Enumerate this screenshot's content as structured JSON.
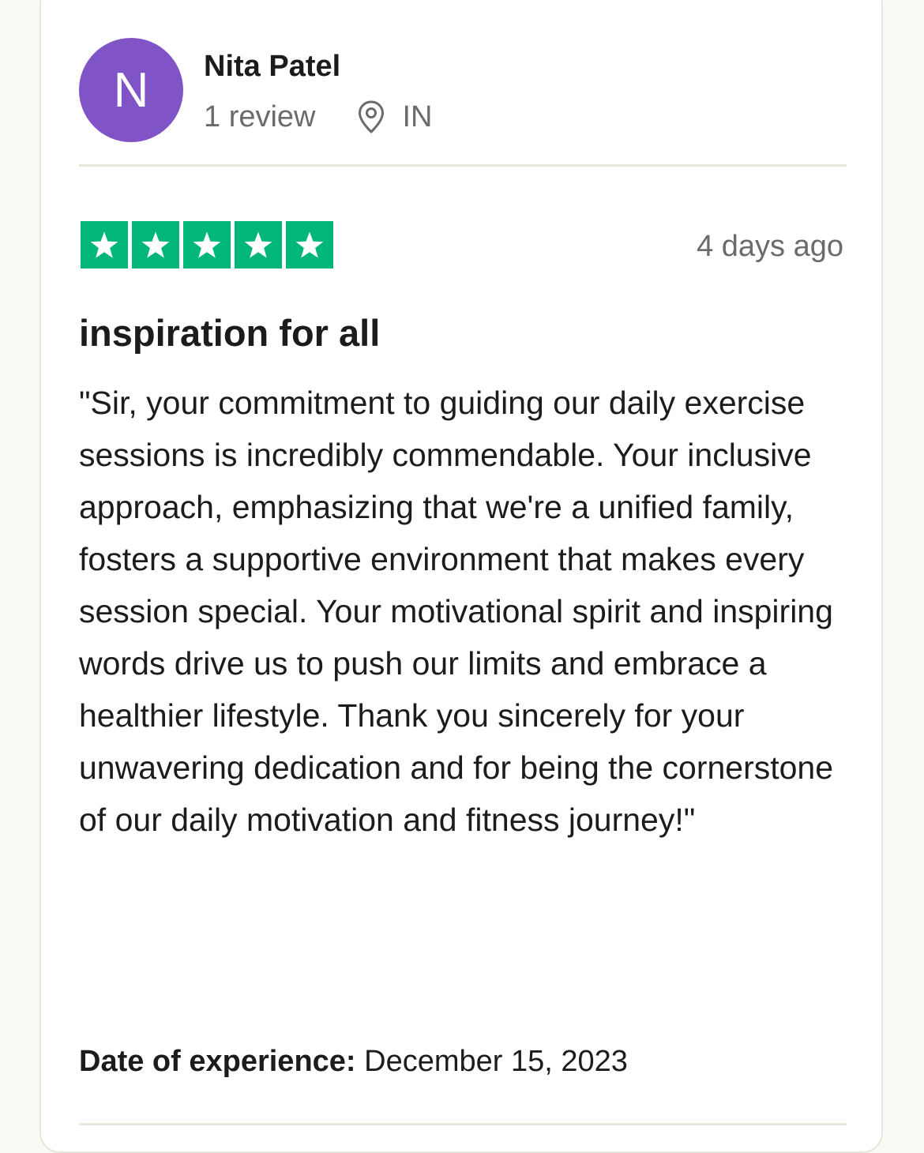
{
  "reviewer": {
    "avatar_initial": "N",
    "avatar_color": "#8054c6",
    "name": "Nita Patel",
    "review_count": "1 review",
    "location_icon": "location-pin-icon",
    "country": "IN"
  },
  "rating": {
    "stars": 5,
    "max_stars": 5,
    "star_color": "#00b67a",
    "star_icon": "star-icon"
  },
  "review": {
    "posted_ago": "4 days ago",
    "title": "inspiration for all",
    "body": "\"Sir, your commitment to guiding our daily exercise sessions is incredibly commendable. Your inclusive approach, emphasizing that we're a unified family, fosters a supportive environment that makes every session special. Your motivational spirit and inspiring words drive us to push our limits and embrace a healthier lifestyle. Thank you sincerely for your unwavering dedication and for being the cornerstone of our daily motivation and fitness journey!\"",
    "experience_label": "Date of experience:",
    "experience_date": "December 15, 2023"
  }
}
